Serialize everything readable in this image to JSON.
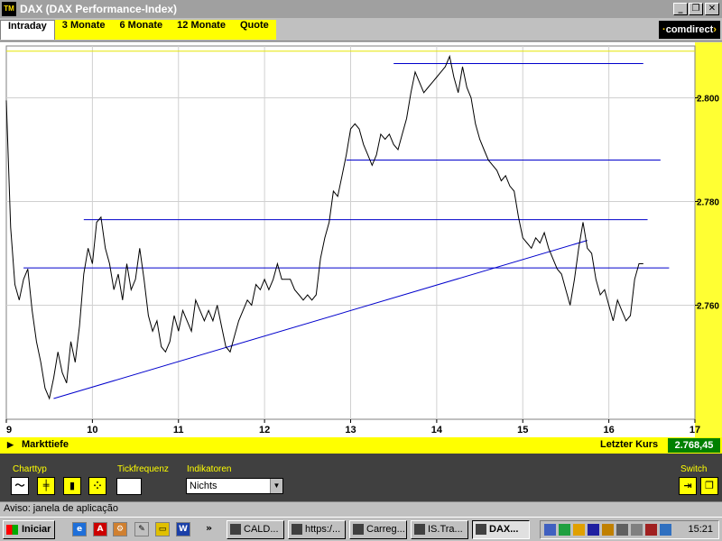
{
  "window": {
    "title": "DAX (DAX Performance-Index)",
    "icon_text": "TM",
    "controls": [
      "minimize-icon",
      "restore-icon",
      "close-icon"
    ]
  },
  "tabs": [
    {
      "label": "Intraday",
      "active": true
    },
    {
      "label": "3 Monate",
      "active": false
    },
    {
      "label": "6 Monate",
      "active": false
    },
    {
      "label": "12 Monate",
      "active": false
    },
    {
      "label": "Quote",
      "active": false
    }
  ],
  "logo": "comdirect",
  "chart_data": {
    "type": "line",
    "title": "",
    "xlabel": "",
    "ylabel": "",
    "x_ticks": [
      "9",
      "10",
      "11",
      "12",
      "13",
      "14",
      "15",
      "16",
      "17"
    ],
    "xlim": [
      9,
      17
    ],
    "y_ticks": [
      "2.800",
      "2.780",
      "2.760"
    ],
    "ylim": [
      2738,
      2810
    ],
    "grid": true,
    "colors": {
      "line": "#000000",
      "drawings": "#0000cc",
      "reference": "#e6e600",
      "axis_panel": "#ffff33"
    },
    "series": [
      {
        "name": "",
        "points": [
          [
            9.0,
            2.7995
          ],
          [
            9.05,
            2.775
          ],
          [
            9.1,
            2.764
          ],
          [
            9.15,
            2.761
          ],
          [
            9.2,
            2.765
          ],
          [
            9.25,
            2.767
          ],
          [
            9.3,
            2.759
          ],
          [
            9.35,
            2.753
          ],
          [
            9.4,
            2.749
          ],
          [
            9.45,
            2.744
          ],
          [
            9.5,
            2.742
          ],
          [
            9.55,
            2.746
          ],
          [
            9.6,
            2.751
          ],
          [
            9.65,
            2.747
          ],
          [
            9.7,
            2.745
          ],
          [
            9.75,
            2.753
          ],
          [
            9.8,
            2.749
          ],
          [
            9.85,
            2.756
          ],
          [
            9.9,
            2.766
          ],
          [
            9.95,
            2.771
          ],
          [
            10.0,
            2.768
          ],
          [
            10.05,
            2.776
          ],
          [
            10.1,
            2.777
          ],
          [
            10.15,
            2.771
          ],
          [
            10.2,
            2.768
          ],
          [
            10.25,
            2.763
          ],
          [
            10.3,
            2.766
          ],
          [
            10.35,
            2.761
          ],
          [
            10.4,
            2.768
          ],
          [
            10.45,
            2.763
          ],
          [
            10.5,
            2.765
          ],
          [
            10.55,
            2.771
          ],
          [
            10.6,
            2.765
          ],
          [
            10.65,
            2.758
          ],
          [
            10.7,
            2.755
          ],
          [
            10.75,
            2.757
          ],
          [
            10.8,
            2.752
          ],
          [
            10.85,
            2.751
          ],
          [
            10.9,
            2.753
          ],
          [
            10.95,
            2.758
          ],
          [
            11.0,
            2.755
          ],
          [
            11.05,
            2.759
          ],
          [
            11.1,
            2.757
          ],
          [
            11.15,
            2.755
          ],
          [
            11.2,
            2.761
          ],
          [
            11.25,
            2.759
          ],
          [
            11.3,
            2.757
          ],
          [
            11.35,
            2.759
          ],
          [
            11.4,
            2.757
          ],
          [
            11.45,
            2.76
          ],
          [
            11.5,
            2.756
          ],
          [
            11.55,
            2.752
          ],
          [
            11.6,
            2.751
          ],
          [
            11.65,
            2.754
          ],
          [
            11.7,
            2.757
          ],
          [
            11.75,
            2.759
          ],
          [
            11.8,
            2.761
          ],
          [
            11.85,
            2.76
          ],
          [
            11.9,
            2.764
          ],
          [
            11.95,
            2.763
          ],
          [
            12.0,
            2.765
          ],
          [
            12.05,
            2.763
          ],
          [
            12.1,
            2.765
          ],
          [
            12.15,
            2.768
          ],
          [
            12.2,
            2.765
          ],
          [
            12.25,
            2.765
          ],
          [
            12.3,
            2.765
          ],
          [
            12.35,
            2.763
          ],
          [
            12.4,
            2.762
          ],
          [
            12.45,
            2.761
          ],
          [
            12.5,
            2.762
          ],
          [
            12.55,
            2.761
          ],
          [
            12.6,
            2.762
          ],
          [
            12.65,
            2.769
          ],
          [
            12.7,
            2.773
          ],
          [
            12.75,
            2.776
          ],
          [
            12.8,
            2.782
          ],
          [
            12.85,
            2.781
          ],
          [
            12.9,
            2.785
          ],
          [
            12.95,
            2.789
          ],
          [
            13.0,
            2.794
          ],
          [
            13.05,
            2.795
          ],
          [
            13.1,
            2.794
          ],
          [
            13.15,
            2.791
          ],
          [
            13.2,
            2.789
          ],
          [
            13.25,
            2.787
          ],
          [
            13.3,
            2.789
          ],
          [
            13.35,
            2.793
          ],
          [
            13.4,
            2.792
          ],
          [
            13.45,
            2.793
          ],
          [
            13.5,
            2.791
          ],
          [
            13.55,
            2.79
          ],
          [
            13.6,
            2.793
          ],
          [
            13.65,
            2.796
          ],
          [
            13.7,
            2.801
          ],
          [
            13.75,
            2.805
          ],
          [
            13.8,
            2.803
          ],
          [
            13.85,
            2.801
          ],
          [
            13.9,
            2.802
          ],
          [
            13.95,
            2.803
          ],
          [
            14.0,
            2.804
          ],
          [
            14.05,
            2.805
          ],
          [
            14.1,
            2.806
          ],
          [
            14.15,
            2.808
          ],
          [
            14.2,
            2.804
          ],
          [
            14.25,
            2.801
          ],
          [
            14.3,
            2.806
          ],
          [
            14.35,
            2.802
          ],
          [
            14.4,
            2.8
          ],
          [
            14.45,
            2.795
          ],
          [
            14.5,
            2.792
          ],
          [
            14.55,
            2.79
          ],
          [
            14.6,
            2.788
          ],
          [
            14.65,
            2.787
          ],
          [
            14.7,
            2.786
          ],
          [
            14.75,
            2.784
          ],
          [
            14.8,
            2.785
          ],
          [
            14.85,
            2.783
          ],
          [
            14.9,
            2.782
          ],
          [
            14.95,
            2.777
          ],
          [
            15.0,
            2.773
          ],
          [
            15.05,
            2.772
          ],
          [
            15.1,
            2.771
          ],
          [
            15.15,
            2.773
          ],
          [
            15.2,
            2.772
          ],
          [
            15.25,
            2.774
          ],
          [
            15.3,
            2.771
          ],
          [
            15.35,
            2.769
          ],
          [
            15.4,
            2.767
          ],
          [
            15.45,
            2.766
          ],
          [
            15.5,
            2.763
          ],
          [
            15.55,
            2.76
          ],
          [
            15.6,
            2.765
          ],
          [
            15.65,
            2.771
          ],
          [
            15.7,
            2.776
          ],
          [
            15.75,
            2.771
          ],
          [
            15.8,
            2.77
          ],
          [
            15.85,
            2.765
          ],
          [
            15.9,
            2.762
          ],
          [
            15.95,
            2.763
          ],
          [
            16.0,
            2.76
          ],
          [
            16.05,
            2.757
          ],
          [
            16.1,
            2.761
          ],
          [
            16.15,
            2.759
          ],
          [
            16.2,
            2.757
          ],
          [
            16.25,
            2.758
          ],
          [
            16.3,
            2.765
          ],
          [
            16.35,
            2.768
          ],
          [
            16.4,
            2.768
          ]
        ]
      }
    ],
    "horizontal_lines": [
      {
        "y": 2.809,
        "x_start": 9.0,
        "x_end": 17.0,
        "color": "#e6e600"
      },
      {
        "y": 2.8066,
        "x_start": 13.5,
        "x_end": 16.4,
        "color": "#0000cc"
      },
      {
        "y": 2.788,
        "x_start": 12.95,
        "x_end": 16.6,
        "color": "#0000cc"
      },
      {
        "y": 2.7765,
        "x_start": 9.9,
        "x_end": 16.45,
        "color": "#0000cc"
      },
      {
        "y": 2.7672,
        "x_start": 9.2,
        "x_end": 16.7,
        "color": "#0000cc"
      }
    ],
    "trendlines": [
      {
        "x": [
          9.55,
          15.75
        ],
        "y": [
          2.742,
          2.7725
        ],
        "color": "#0000cc"
      }
    ]
  },
  "markt_bar": {
    "label": "Markttiefe",
    "last_label": "Letzter Kurs",
    "last_value": "2.768,45"
  },
  "controls": {
    "charttyp_label": "Charttyp",
    "tickfrequenz_label": "Tickfrequenz",
    "tickfrequenz_value": "",
    "indikatoren_label": "Indikatoren",
    "indikatoren_value": "Nichts",
    "switch_label": "Switch"
  },
  "status": {
    "text": "Aviso: janela de aplicação"
  },
  "taskbar": {
    "start_label": "Iniciar",
    "tasks": [
      {
        "label": "CALD...",
        "active": false
      },
      {
        "label": "https:/...",
        "active": false
      },
      {
        "label": "Carreg...",
        "active": false
      },
      {
        "label": "IS.Tra...",
        "active": false
      },
      {
        "label": "DAX...",
        "active": true
      }
    ],
    "chevron": "»",
    "clock": "15:21"
  }
}
